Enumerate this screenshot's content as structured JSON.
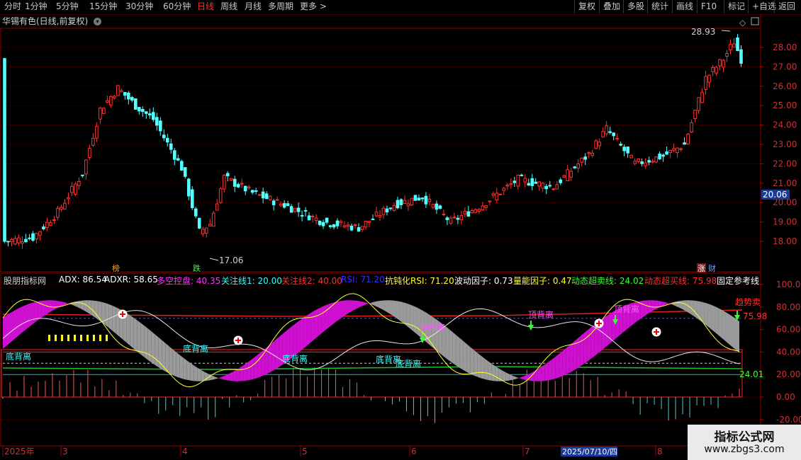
{
  "toolbar": {
    "periods": [
      "分时",
      "1分钟",
      "5分钟",
      "15分钟",
      "30分钟",
      "60分钟",
      "日线",
      "周线",
      "月线",
      "多周期",
      "更多 >"
    ],
    "active_period": "日线",
    "right_buttons": [
      "复权",
      "叠加",
      "多股",
      "统计",
      "画线",
      "F10",
      "标记",
      "+自选",
      "返回"
    ]
  },
  "stock": {
    "title": "华锡有色(日线,前复权)",
    "high_label": "28.93",
    "low_label": "17.06",
    "current_price": "20.06",
    "price_ticks": [
      "28.00",
      "27.00",
      "26.00",
      "25.00",
      "24.00",
      "23.00",
      "22.00",
      "21.00",
      "20.00",
      "19.00",
      "18.00"
    ],
    "markers": {
      "bang": "榜",
      "die": "跌",
      "zhang": "涨",
      "cai": "财"
    }
  },
  "indicator": {
    "parts": [
      {
        "text": "股朋指标网",
        "color": "#d0d0d0"
      },
      {
        "text": "ADX: 86.54",
        "color": "#ffffff"
      },
      {
        "text": "ADXR: 58.65",
        "color": "#ffffff"
      },
      {
        "text": "多空控盘: 40.35",
        "color": "#ff33ff"
      },
      {
        "text": "关注线1: 20.00",
        "color": "#33ffff"
      },
      {
        "text": "关注线2: 40.00",
        "color": "#ff3030"
      },
      {
        "text": "RSI: 71.20",
        "color": "#3333ff"
      },
      {
        "text": "抗钝化RSI: 71.20",
        "color": "#ffff33"
      },
      {
        "text": "波动因子: 0.73",
        "color": "#ffffff"
      },
      {
        "text": "量能因子: 0.47",
        "color": "#ffff33"
      },
      {
        "text": "动态超卖线: 24.02",
        "color": "#33ff33"
      },
      {
        "text": "动态超买线: 75.98",
        "color": "#ff3030"
      },
      {
        "text": "固定参考线",
        "color": "#ffffff"
      }
    ],
    "y_ticks": [
      "100.0",
      "80.00",
      "60.00",
      "40.00",
      "20.00",
      "0.00",
      "-20.00"
    ],
    "overbought_value": "75.98",
    "oversold_value": "24.01",
    "annotations": {
      "top_div": "顶背离",
      "bottom_div": "底背离",
      "trend_sell": "趋势卖"
    }
  },
  "time_axis": {
    "labels": [
      "2025年",
      "3",
      "4",
      "5",
      "6",
      "7",
      "8"
    ],
    "cursor_date": "2025/07/10/四"
  },
  "watermark": {
    "line1": "指标公式网",
    "line2": "www.zbgs3.com"
  },
  "colors": {
    "up": "#ff3232",
    "down": "#54ffff",
    "grid": "#7a0000",
    "magenta": "#d010d0",
    "gray": "#9a9a9a",
    "yellow": "#ffff00"
  }
}
